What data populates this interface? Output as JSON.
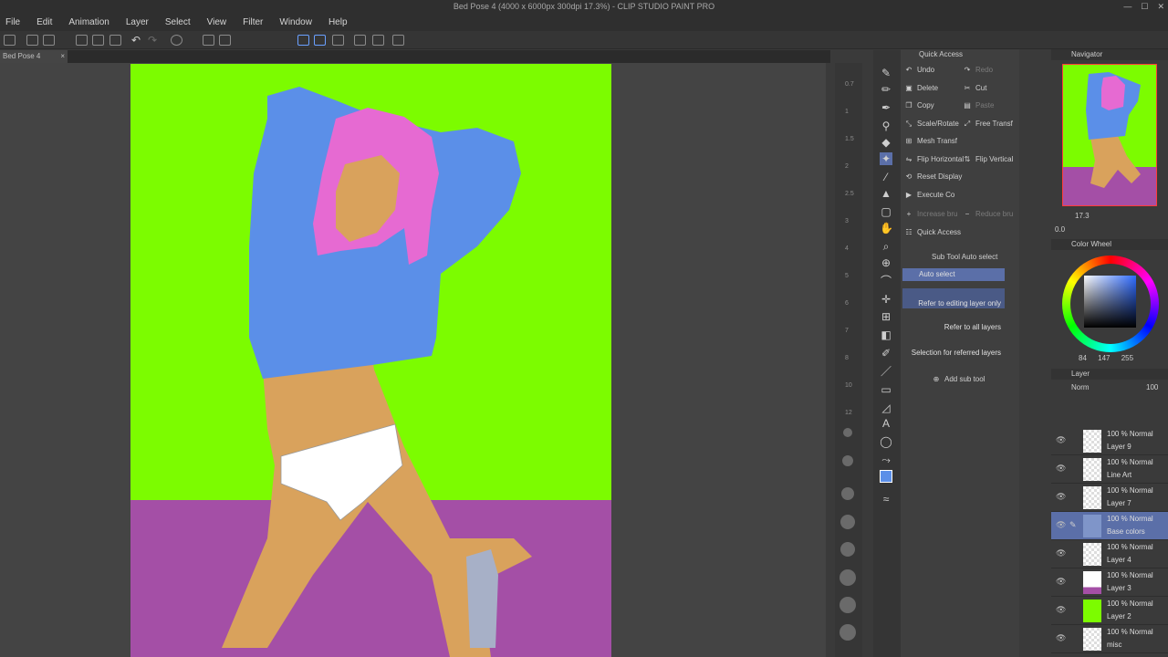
{
  "window": {
    "title": "Bed Pose 4 (4000 x 6000px 300dpi 17.3%) - CLIP STUDIO PAINT PRO"
  },
  "menu": [
    "File",
    "Edit",
    "Animation",
    "Layer",
    "Select",
    "View",
    "Filter",
    "Window",
    "Help"
  ],
  "document_tab": {
    "label": "Bed Pose 4",
    "close": "×"
  },
  "ruler_marks": [
    "0.7",
    "1",
    "1.5",
    "2",
    "2.5",
    "3",
    "4",
    "5",
    "6",
    "7",
    "8",
    "10",
    "12"
  ],
  "quick_access": {
    "title": "Quick Access",
    "items": [
      {
        "label": "Undo",
        "icon": "undo-icon"
      },
      {
        "label": "Redo",
        "icon": "redo-icon",
        "disabled": true
      },
      {
        "label": "Delete",
        "icon": "delete-icon"
      },
      {
        "label": "Cut",
        "icon": "cut-icon"
      },
      {
        "label": "Copy",
        "icon": "copy-icon"
      },
      {
        "label": "Paste",
        "icon": "paste-icon",
        "disabled": true
      },
      {
        "label": "Scale/Rotate",
        "icon": "scale-icon"
      },
      {
        "label": "Free Transf",
        "icon": "transform-icon"
      },
      {
        "label": "Mesh Transf",
        "icon": "mesh-icon"
      },
      {
        "label": "Flip Horizontal",
        "icon": "flip-horizontal-icon"
      },
      {
        "label": "Flip Vertical",
        "icon": "flip-vertical-icon"
      },
      {
        "label": "Reset Display",
        "icon": "reset-icon"
      },
      {
        "label": "Execute Co",
        "icon": "execute-icon"
      },
      {
        "label": "Increase bru",
        "icon": "increase-icon",
        "disabled": true
      },
      {
        "label": "Reduce bru",
        "icon": "reduce-icon",
        "disabled": true
      },
      {
        "label": "Quick Access",
        "icon": "quick-access-icon"
      }
    ]
  },
  "sub_tool": {
    "title": "Sub Tool Auto select",
    "group": "Auto select",
    "items": [
      "Refer to editing layer only",
      "Refer to all layers",
      "Selection for referred layers"
    ],
    "add_label": "Add sub tool"
  },
  "navigator": {
    "title": "Navigator",
    "zoom": "17.3",
    "angle": "0.0"
  },
  "color_wheel": {
    "title": "Color Wheel",
    "h": "84",
    "s": "147",
    "v": "255",
    "current_color": "#5b8fe8"
  },
  "layer_panel": {
    "title": "Layer",
    "blend_mode": "Norm",
    "opacity": "100",
    "layers": [
      {
        "mode": "100 % Normal",
        "name": "Layer 9",
        "selected": false
      },
      {
        "mode": "100 % Normal",
        "name": "Line Art",
        "selected": false
      },
      {
        "mode": "100 % Normal",
        "name": "Layer 7",
        "selected": false
      },
      {
        "mode": "100 % Normal",
        "name": "Base colors",
        "selected": true
      },
      {
        "mode": "100 % Normal",
        "name": "Layer 4",
        "selected": false
      },
      {
        "mode": "100 % Normal",
        "name": "Layer 3",
        "selected": false
      },
      {
        "mode": "100 % Normal",
        "name": "Layer 2",
        "selected": false
      },
      {
        "mode": "100 % Normal",
        "name": "misc",
        "selected": false
      }
    ]
  },
  "colors": {
    "canvas_background": "#7cfc00",
    "floor": "#a44fa6",
    "shirt": "#5b8fe8",
    "hair": "#e66ad2",
    "skin": "#d9a25c",
    "accent": "#5b6fa8"
  }
}
